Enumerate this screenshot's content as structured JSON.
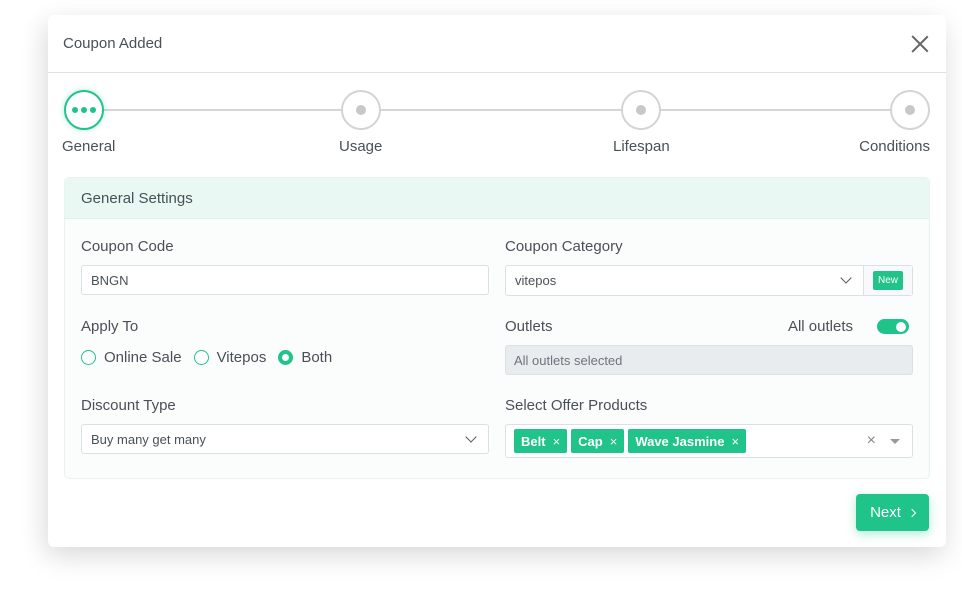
{
  "modal": {
    "title": "Coupon Added",
    "close_icon": "close-icon"
  },
  "stepper": {
    "steps": [
      {
        "label": "General",
        "state": "active"
      },
      {
        "label": "Usage",
        "state": "pending"
      },
      {
        "label": "Lifespan",
        "state": "pending"
      },
      {
        "label": "Conditions",
        "state": "pending"
      }
    ]
  },
  "general_settings": {
    "title": "General Settings",
    "coupon_code": {
      "label": "Coupon Code",
      "value": "BNGN"
    },
    "coupon_category": {
      "label": "Coupon Category",
      "value": "vitepos",
      "new_button": "New"
    },
    "apply_to": {
      "label": "Apply To",
      "options": [
        {
          "label": "Online Sale",
          "checked": false
        },
        {
          "label": "Vitepos",
          "checked": false
        },
        {
          "label": "Both",
          "checked": true
        }
      ]
    },
    "outlets": {
      "label": "Outlets",
      "toggle_label": "All outlets",
      "toggle_on": true,
      "value": "All outlets selected"
    },
    "discount_type": {
      "label": "Discount Type",
      "value": "Buy many get many"
    },
    "offer_products": {
      "label": "Select Offer Products",
      "tags": [
        "Belt",
        "Cap",
        "Wave Jasmine"
      ],
      "remove_glyph": "×",
      "clear_glyph": "×"
    }
  },
  "footer": {
    "next_label": "Next"
  },
  "colors": {
    "accent": "#20c38a",
    "header_bg": "#e9f8f3",
    "disabled_bg": "#e9ecef"
  }
}
